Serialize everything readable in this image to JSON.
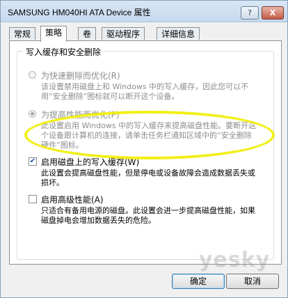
{
  "window": {
    "title": "SAMSUNG HM040HI ATA Device 属性",
    "help_label": "?",
    "close_label": "X"
  },
  "tabs": [
    {
      "label": "常规"
    },
    {
      "label": "策略"
    },
    {
      "label": "卷"
    },
    {
      "label": "驱动程序"
    },
    {
      "label": "详细信息"
    }
  ],
  "group": {
    "title": "写入缓存和安全删除"
  },
  "options": {
    "quick_removal": {
      "label": "为快速删除而优化(R)",
      "desc": "该设置禁用磁盘上和 Windows 中的写入缓存，因此您可以不用“安全删除”图标就可以断开这个设备。"
    },
    "performance": {
      "label": "为提高性能而优化(P)",
      "desc": "此设置启用 Windows 中的写入缓存来提高磁盘性能。要断开这个设备跟计算机的连接，请单击任务栏通知区域中的“安全删除硬件”图标。"
    },
    "write_cache": {
      "label": "启用磁盘上的写入缓存(W)",
      "desc": "此设置会提高磁盘性能，但是停电或设备故障会造成数据丢失或损坏。"
    },
    "advanced": {
      "label": "启用高级性能(A)",
      "desc": "只适合有备用电源的磁盘。此设置会进一步提高磁盘性能，如果磁盘掉电会增加数据丢失的危险。"
    }
  },
  "buttons": {
    "ok": "确定",
    "cancel": "取消"
  },
  "watermark": "yesky"
}
